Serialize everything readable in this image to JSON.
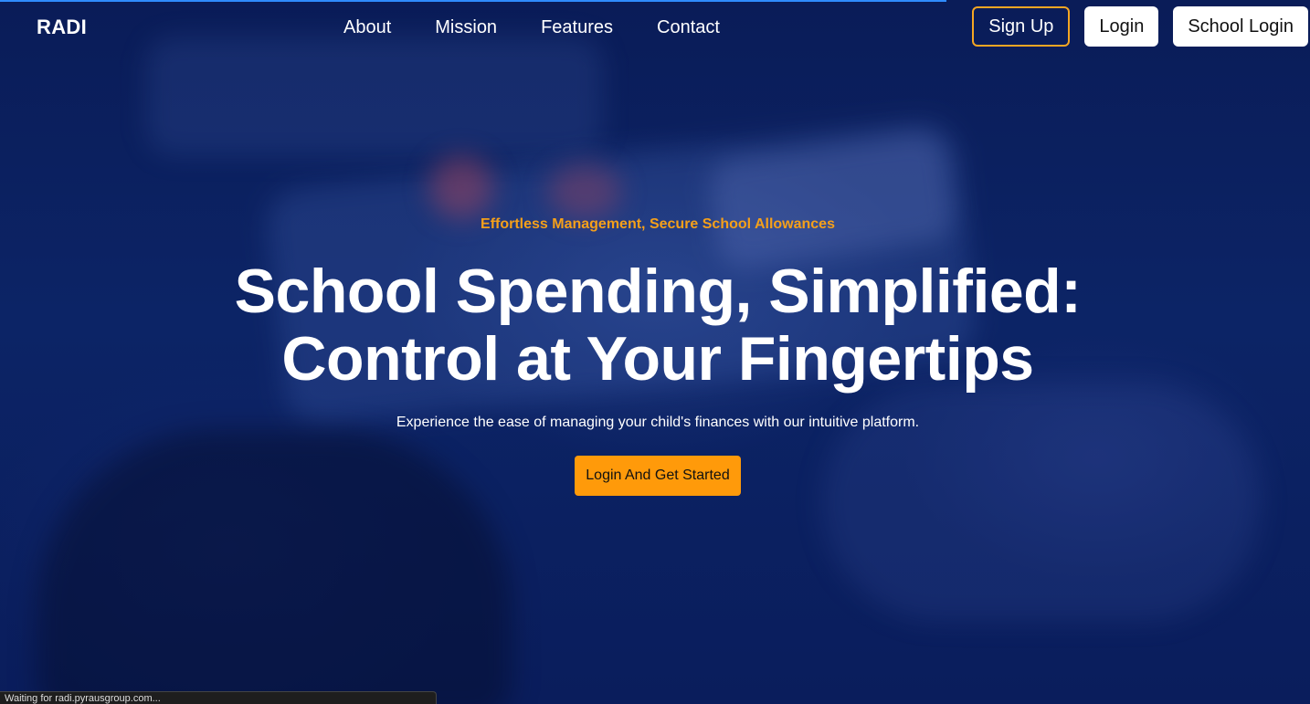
{
  "nav": {
    "brand": "RADI",
    "links": [
      "About",
      "Mission",
      "Features",
      "Contact"
    ],
    "signup_label": "Sign Up",
    "login_label": "Login",
    "school_login_label": "School Login"
  },
  "hero": {
    "eyebrow": "Effortless Management, Secure School Allowances",
    "headline_line1": "School Spending, Simplified:",
    "headline_line2": "Control at Your Fingertips",
    "subtitle": "Experience the ease of managing your child's finances with our intuitive platform.",
    "cta_label": "Login And Get Started"
  },
  "status_bar": {
    "text": "Waiting for radi.pyrausgroup.com..."
  },
  "colors": {
    "background": "#0b1f5c",
    "accent": "#ff9a0a",
    "eyebrow": "#f5a01a",
    "loading_bar": "#2f8cff"
  }
}
